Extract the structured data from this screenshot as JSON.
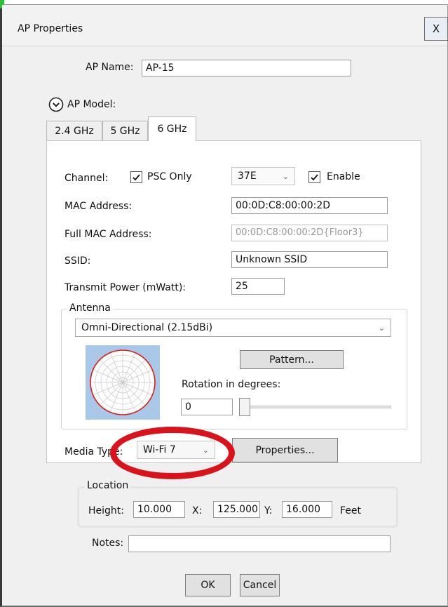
{
  "window": {
    "title": "AP Properties",
    "close_label": "X"
  },
  "ap_name": {
    "label": "AP Name:",
    "value": "AP-15"
  },
  "ap_model": {
    "label": "AP Model:"
  },
  "tabs": [
    {
      "label": "2.4 GHz",
      "active": false
    },
    {
      "label": "5 GHz",
      "active": false
    },
    {
      "label": "6 GHz",
      "active": true
    }
  ],
  "radio": {
    "channel_label": "Channel:",
    "psc_only_label": "PSC Only",
    "psc_only_checked": true,
    "channel_value": "37E",
    "enable_label": "Enable",
    "enable_checked": true,
    "mac_label": "MAC Address:",
    "mac_value": "00:0D:C8:00:00:2D",
    "full_mac_label": "Full MAC Address:",
    "full_mac_value": "00:0D:C8:00:00:2D{Floor3}",
    "ssid_label": "SSID:",
    "ssid_value": "Unknown SSID",
    "power_label": "Transmit Power (mWatt):",
    "power_value": "25"
  },
  "antenna": {
    "group_label": "Antenna",
    "type_value": "Omni-Directional (2.15dBi)",
    "pattern_button": "Pattern...",
    "rotation_label": "Rotation in degrees:",
    "rotation_value": "0",
    "rotation_slider_fraction": 0
  },
  "media": {
    "label": "Media Type:",
    "value": "Wi-Fi 7",
    "properties_button": "Properties..."
  },
  "location": {
    "group_label": "Location",
    "height_label": "Height:",
    "height_value": "10.000",
    "x_label": "X:",
    "x_value": "125.000",
    "y_label": "Y:",
    "y_value": "16.000",
    "units": "Feet"
  },
  "notes": {
    "label": "Notes:",
    "value": ""
  },
  "buttons": {
    "ok": "OK",
    "cancel": "Cancel"
  },
  "colors": {
    "highlight": "#d9131b",
    "pattern_line": "#e11b1b",
    "pattern_bg": "#a9c7e6"
  },
  "icons": {
    "expand": "chevron-down-circle-icon",
    "check": "checkmark-icon",
    "dropdown": "chevron-down-icon"
  }
}
